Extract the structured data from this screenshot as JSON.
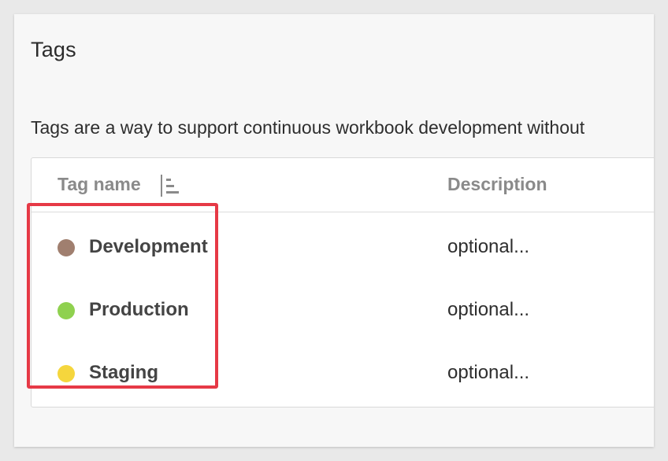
{
  "panel": {
    "title": "Tags",
    "description": "Tags are a way to support continuous workbook development without"
  },
  "table": {
    "columns": {
      "name": "Tag name",
      "description": "Description"
    },
    "rows": [
      {
        "name": "Development",
        "description": "optional...",
        "color": "#a07f6f"
      },
      {
        "name": "Production",
        "description": "optional...",
        "color": "#8fd14f"
      },
      {
        "name": "Staging",
        "description": "optional...",
        "color": "#f5d63d"
      }
    ]
  },
  "icons": {
    "sort": "sort-icon",
    "tag_dot": "tag-color-dot"
  },
  "colors": {
    "highlight": "#e63946"
  }
}
